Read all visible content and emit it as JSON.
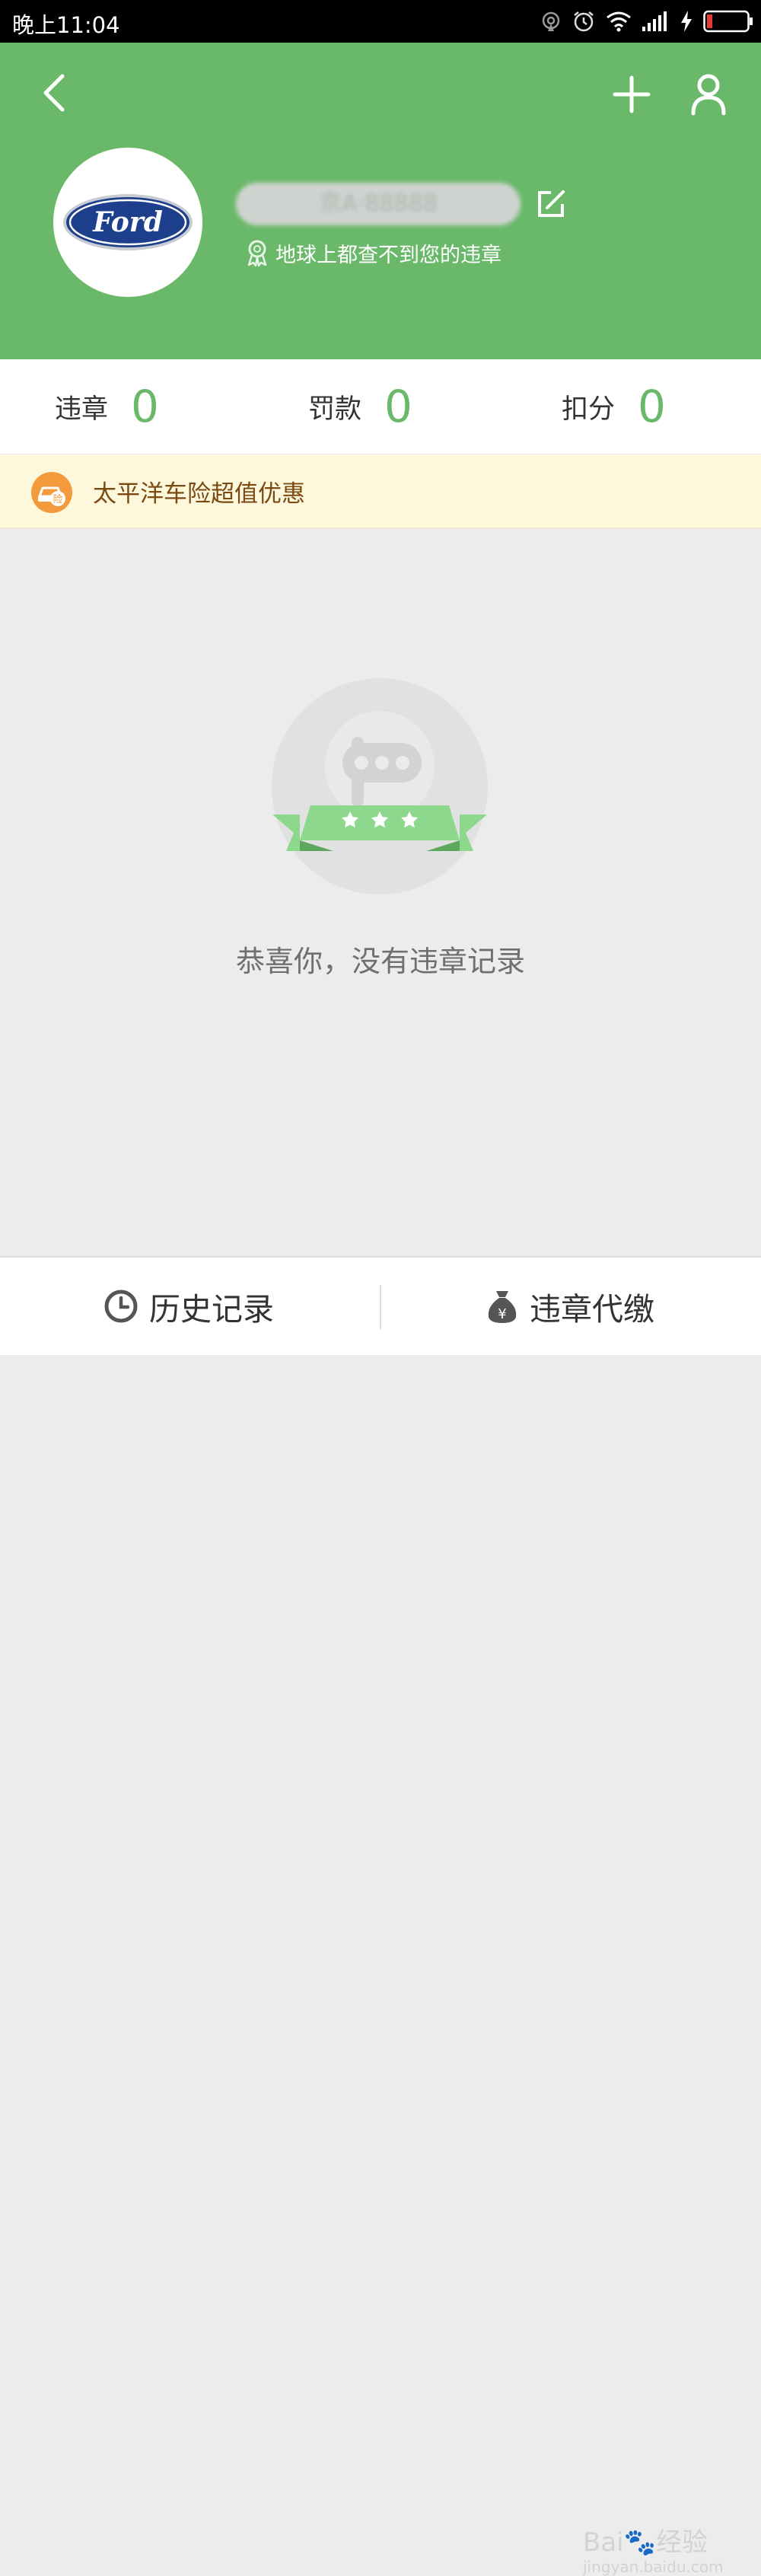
{
  "status_bar": {
    "time": "晚上11:04"
  },
  "header": {
    "bg_color": "#6ab96a",
    "brand": "Ford",
    "plate": "京A·88888",
    "badge_text": "地球上都查不到您的违章"
  },
  "stats": [
    {
      "label": "违章",
      "value": "0"
    },
    {
      "label": "罚款",
      "value": "0"
    },
    {
      "label": "扣分",
      "value": "0"
    }
  ],
  "promo": {
    "text": "太平洋车险超值优惠",
    "icon_char": "险"
  },
  "empty_state": {
    "message": "恭喜你，没有违章记录"
  },
  "bottom_tabs": [
    {
      "label": "历史记录",
      "icon": "clock-icon"
    },
    {
      "label": "违章代缴",
      "icon": "money-bag-icon"
    }
  ],
  "watermark": {
    "main": "Bai🐾经验",
    "sub": "jingyan.baidu.com"
  }
}
